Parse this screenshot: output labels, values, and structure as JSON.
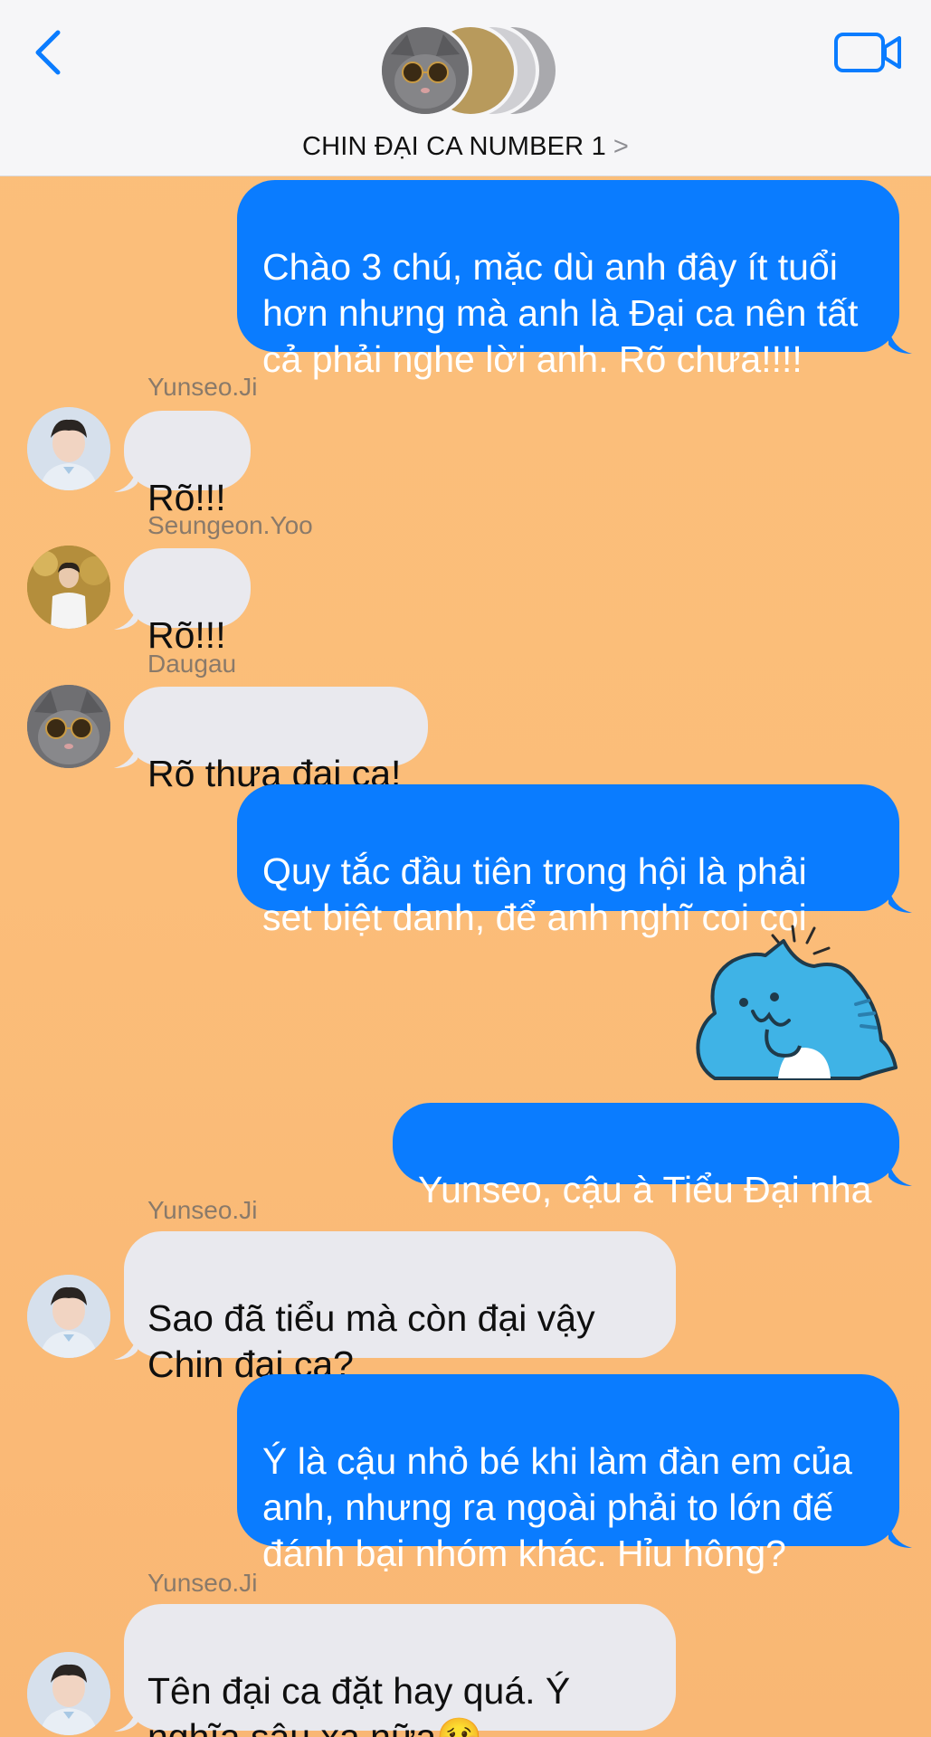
{
  "header": {
    "title": "CHIN ĐẠI CA NUMBER 1",
    "chevron": ">",
    "back_icon": "chevron-left-icon",
    "video_icon": "video-camera-icon",
    "accent_color": "#0a7cff"
  },
  "messages": [
    {
      "direction": "out",
      "text": "Chào 3 chú, mặc dù anh đây ít tuổi\nhơn nhưng mà anh là Đại ca nên tất\ncả phải nghe lời anh. Rõ chưa!!!!"
    },
    {
      "direction": "in",
      "sender": "Yunseo.Ji",
      "text": "Rõ!!!"
    },
    {
      "direction": "in",
      "sender": "Seungeon.Yoo",
      "text": "Rõ!!!"
    },
    {
      "direction": "in",
      "sender": "Daugau",
      "text": "Rõ thưa đại ca!"
    },
    {
      "direction": "out",
      "text": "Quy tắc đầu tiên trong hội là phải\nset biệt danh, để anh nghĩ coi coi"
    },
    {
      "direction": "out",
      "type": "sticker",
      "sticker": "blue-cat-thinking-sticker"
    },
    {
      "direction": "out",
      "text": "Yunseo, cậu à Tiểu Đại nha"
    },
    {
      "direction": "in",
      "sender": "Yunseo.Ji",
      "text": "Sao đã tiểu mà còn đại vậy\nChin đại ca?"
    },
    {
      "direction": "out",
      "text": "Ý là cậu nhỏ bé khi làm đàn em của\nanh, nhưng ra ngoài phải to lớn đế\nđánh bại nhóm khác. Hỉu hông?"
    },
    {
      "direction": "in",
      "sender": "Yunseo.Ji",
      "text": "Tên đại ca đặt hay quá. Ý\nnghĩa sâu xa nữa🥴"
    }
  ],
  "colors": {
    "outgoing_bubble": "#0a7cff",
    "incoming_bubble": "#e9e9ee",
    "background": "#fbbf7a"
  }
}
